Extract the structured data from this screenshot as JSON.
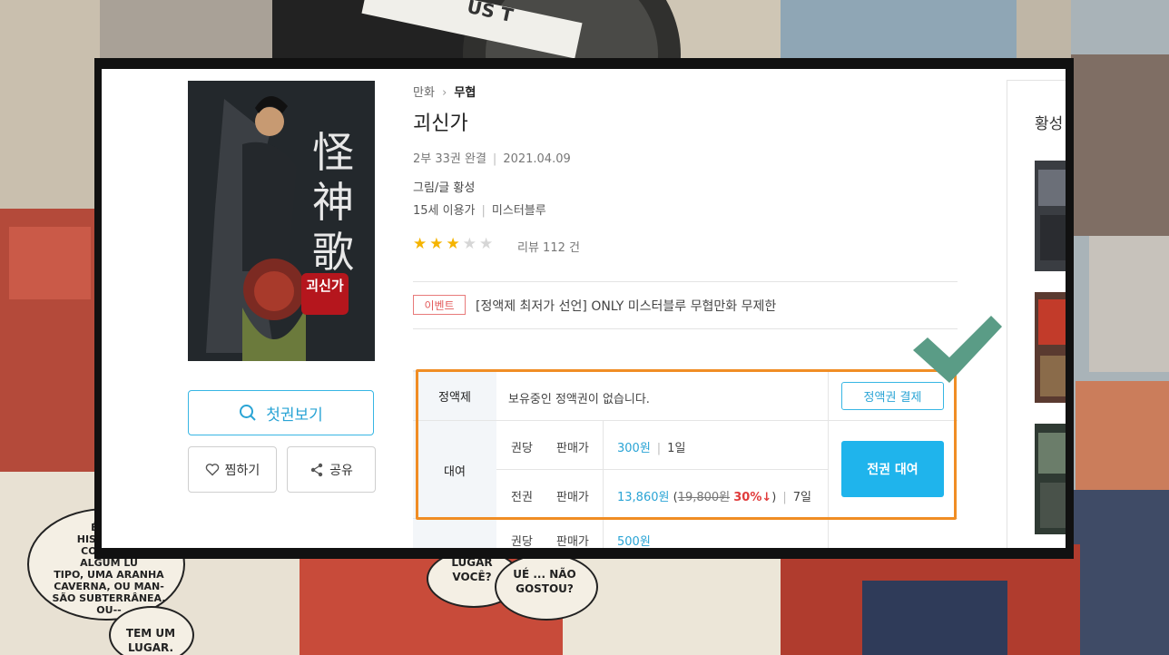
{
  "breadcrumb": {
    "category": "만화",
    "separator": "›",
    "genre": "무협"
  },
  "book": {
    "title": "괴신가",
    "volumes": "2부 33권 완결",
    "date": "2021.04.09",
    "author_label": "그림/글 황성",
    "age": "15세 이용가",
    "publisher": "미스터블루",
    "rating": 3,
    "rating_max": 5,
    "review_count": "리뷰 112 건"
  },
  "actions": {
    "first_volume": "첫권보기",
    "wishlist": "찜하기",
    "share": "공유"
  },
  "event": {
    "tag": "이벤트",
    "text": "[정액제 최저가 선언] ONLY 미스터블루 무협만화 무제한"
  },
  "pricing": {
    "subscription": {
      "label": "정액제",
      "message": "보유중인 정액권이 없습니다.",
      "button": "정액권 결제"
    },
    "rental": {
      "label": "대여",
      "per_volume": {
        "type": "권당",
        "price_label": "판매가",
        "price": "300원",
        "period": "1일"
      },
      "all_volumes": {
        "type": "전권",
        "price_label": "판매가",
        "price": "13,860원",
        "original_price": "19,800원",
        "discount": "30%↓",
        "period": "7일"
      },
      "button": "전권 대여"
    },
    "purchase_partial": {
      "type": "권당",
      "price_label": "판매가",
      "price": "500원"
    }
  },
  "sidebar": {
    "title": "황성"
  },
  "background_text": {
    "bubble1": "É UMA\nHISTÓRIA E\nCOM FRIO\nALGUM LU\nTIPO, UMA ARANHA\nCAVERNA, OU MAN-\nSÃO SUBTERRÂNEA,\nOU--",
    "bubble2": "TEM UM\nLUGAR.",
    "bubble3": "LUGAR\nVOCÊ?",
    "bubble4": "UÉ ... NÃO\nGOSTOU?",
    "camera_text": "US T"
  },
  "colors": {
    "accent_blue": "#1fb4ec",
    "highlight_orange": "#f08d24",
    "check_green": "#5a9c86",
    "star_gold": "#f5b400"
  }
}
